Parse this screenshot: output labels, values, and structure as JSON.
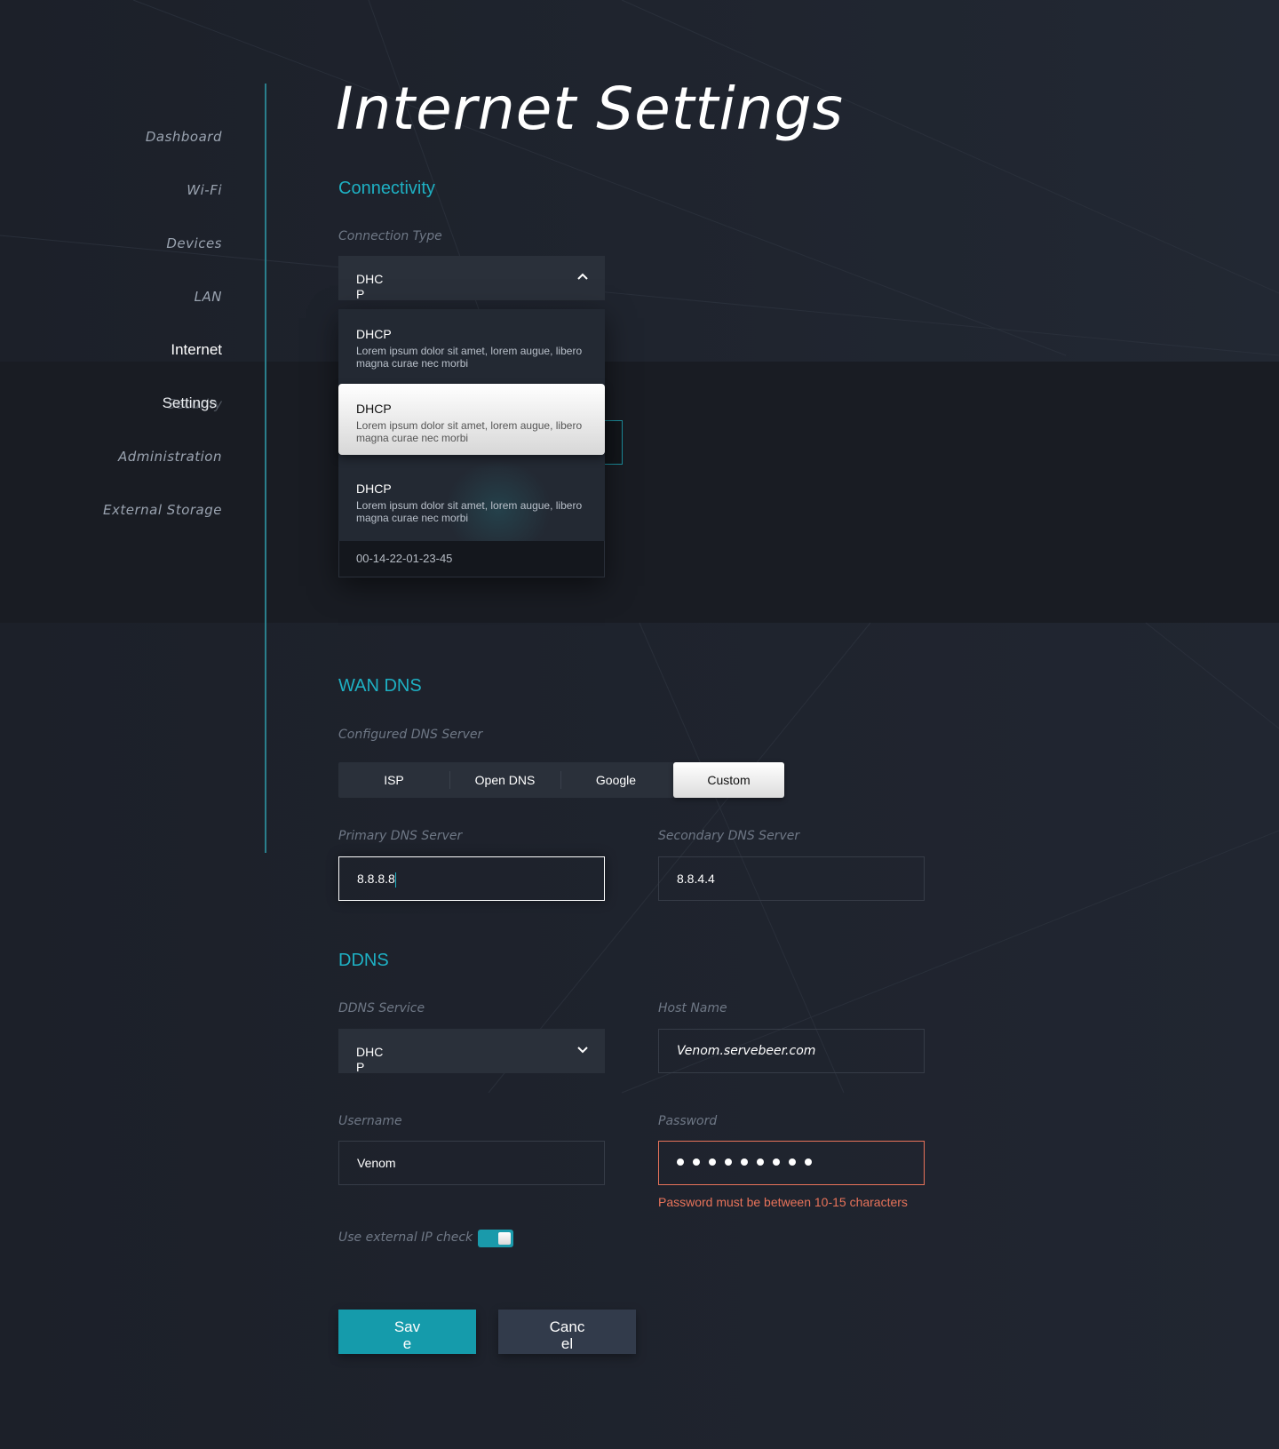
{
  "sidebar": {
    "items": [
      {
        "label": "Dashboard"
      },
      {
        "label": "Wi-Fi"
      },
      {
        "label": "Devices"
      },
      {
        "label": "LAN"
      },
      {
        "label": "Internet"
      },
      {
        "label": "Security"
      },
      {
        "label": "Administration"
      },
      {
        "label": "External Storage"
      }
    ],
    "active_label": "Internet",
    "active_sub_label": "Settings"
  },
  "header": {
    "title": "Internet Settings"
  },
  "connectivity": {
    "section_title": "Connectivity",
    "connection_type_label": "Connection Type",
    "connection_type_value": "DHCP",
    "dropdown_open": true,
    "options": [
      {
        "title": "DHCP",
        "description": "Lorem ipsum dolor sit amet, lorem augue, libero magna curae nec morbi"
      },
      {
        "title": "DHCP",
        "description": "Lorem ipsum dolor sit amet, lorem augue, libero magna curae nec morbi",
        "highlighted": true
      },
      {
        "title": "DHCP",
        "description": "Lorem ipsum dolor sit amet, lorem augue, libero magna curae nec morbi"
      }
    ],
    "mac_address": "00-14-22-01-23-45"
  },
  "wan_dns": {
    "section_title": "WAN DNS",
    "configured_label": "Configured DNS Server",
    "options": [
      "ISP",
      "Open DNS",
      "Google",
      "Custom"
    ],
    "selected": "Custom",
    "primary_label": "Primary DNS Server",
    "primary_value": "8.8.8.8",
    "secondary_label": "Secondary DNS Server",
    "secondary_value": "8.8.4.4"
  },
  "ddns": {
    "section_title": "DDNS",
    "service_label": "DDNS Service",
    "service_value": "DHCP",
    "host_label": "Host Name",
    "host_value": "Venom.servebeer.com",
    "username_label": "Username",
    "username_value": "Venom",
    "password_label": "Password",
    "password_length": 9,
    "password_error": "Password must be between 10-15 characters",
    "external_ip_label": "Use external IP check",
    "external_ip_enabled": true
  },
  "actions": {
    "save_label": "Save",
    "cancel_label": "Cancel"
  },
  "colors": {
    "accent": "#1eb0c3",
    "error": "#e8735a",
    "save": "#159bab",
    "cancel": "#323b4b"
  }
}
